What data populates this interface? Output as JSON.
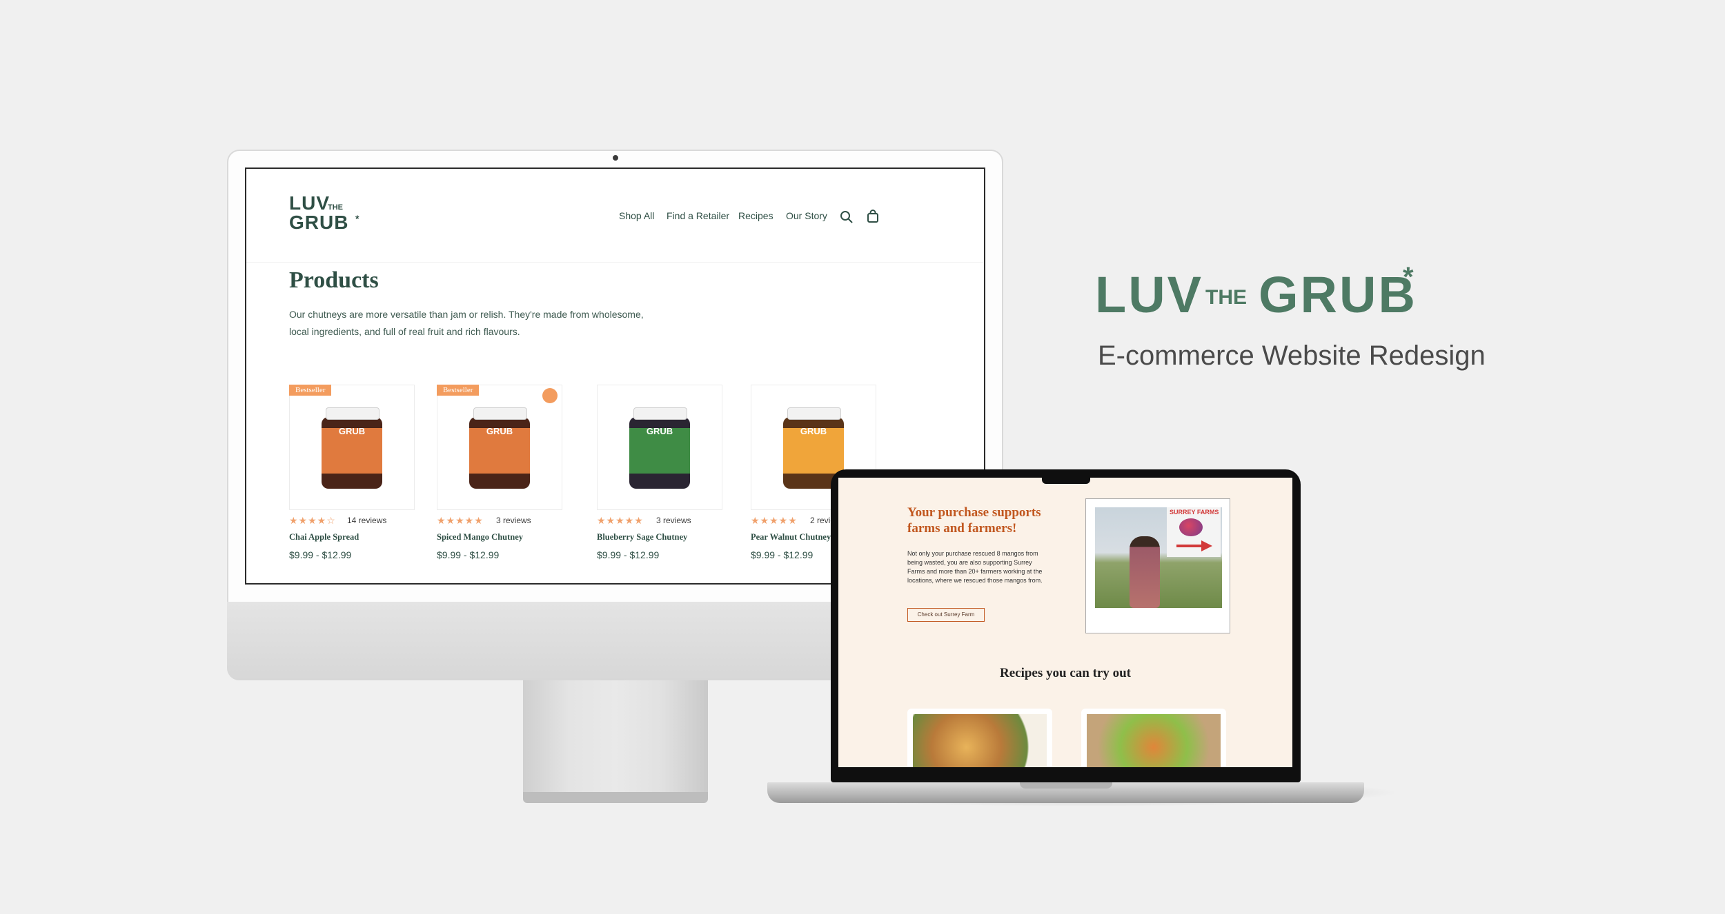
{
  "brand": {
    "logo_line1": "LUV",
    "logo_the": "THE",
    "logo_line2": "GRUB",
    "logo_star": "*",
    "full_logo": "LUV THE GRUB*",
    "subtitle": "E-commerce Website Redesign",
    "color_green": "#4e7a64",
    "color_dark_green": "#2f4f45",
    "color_orange": "#f39c5e"
  },
  "desktop": {
    "nav": [
      "Shop All",
      "Find a Retailer",
      "Recipes",
      "Our Story"
    ],
    "icons": [
      "search-icon",
      "shopping-bag-icon"
    ],
    "page_title": "Products",
    "intro_line1": "Our chutneys are more versatile than jam or relish. They're made from wholesome,",
    "intro_line2": "local ingredients, and full of real fruit and rich flavours.",
    "products": [
      {
        "name": "Chai Apple Spread",
        "price": "$9.99 - $12.99",
        "stars": "★★★★☆",
        "rating": 4,
        "reviews": "14 reviews",
        "badge": "Bestseller",
        "label_color": "#e07a3e"
      },
      {
        "name": "Spiced Mango Chutney",
        "price": "$9.99 - $12.99",
        "stars": "★★★★★",
        "rating": 5,
        "reviews": "3 reviews",
        "badge": "Bestseller",
        "label_color": "#e07a3e"
      },
      {
        "name": "Blueberry Sage Chutney",
        "price": "$9.99 - $12.99",
        "stars": "★★★★★",
        "rating": 5,
        "reviews": "3 reviews",
        "badge": "",
        "label_color": "#3f8c45"
      },
      {
        "name": "Pear Walnut Chutney",
        "price": "$9.99 - $12.99",
        "stars": "★★★★★",
        "rating": 5,
        "reviews": "2 reviews",
        "badge": "",
        "label_color": "#f0a53a"
      }
    ]
  },
  "laptop": {
    "heading_line1": "Your purchase supports",
    "heading_line2": "farms and farmers!",
    "body_line1": "Not only your purchase rescued 8 mangos from",
    "body_line2": "being wasted, you are also supporting Surrey",
    "body_line3": "Farms and more than 20+ farmers working at the",
    "body_line4": "locations, where we rescued those mangos from.",
    "cta": "Check out Surrey Farm",
    "sign_text": "SURREY FARMS",
    "recipes_heading": "Recipes you can try out"
  }
}
